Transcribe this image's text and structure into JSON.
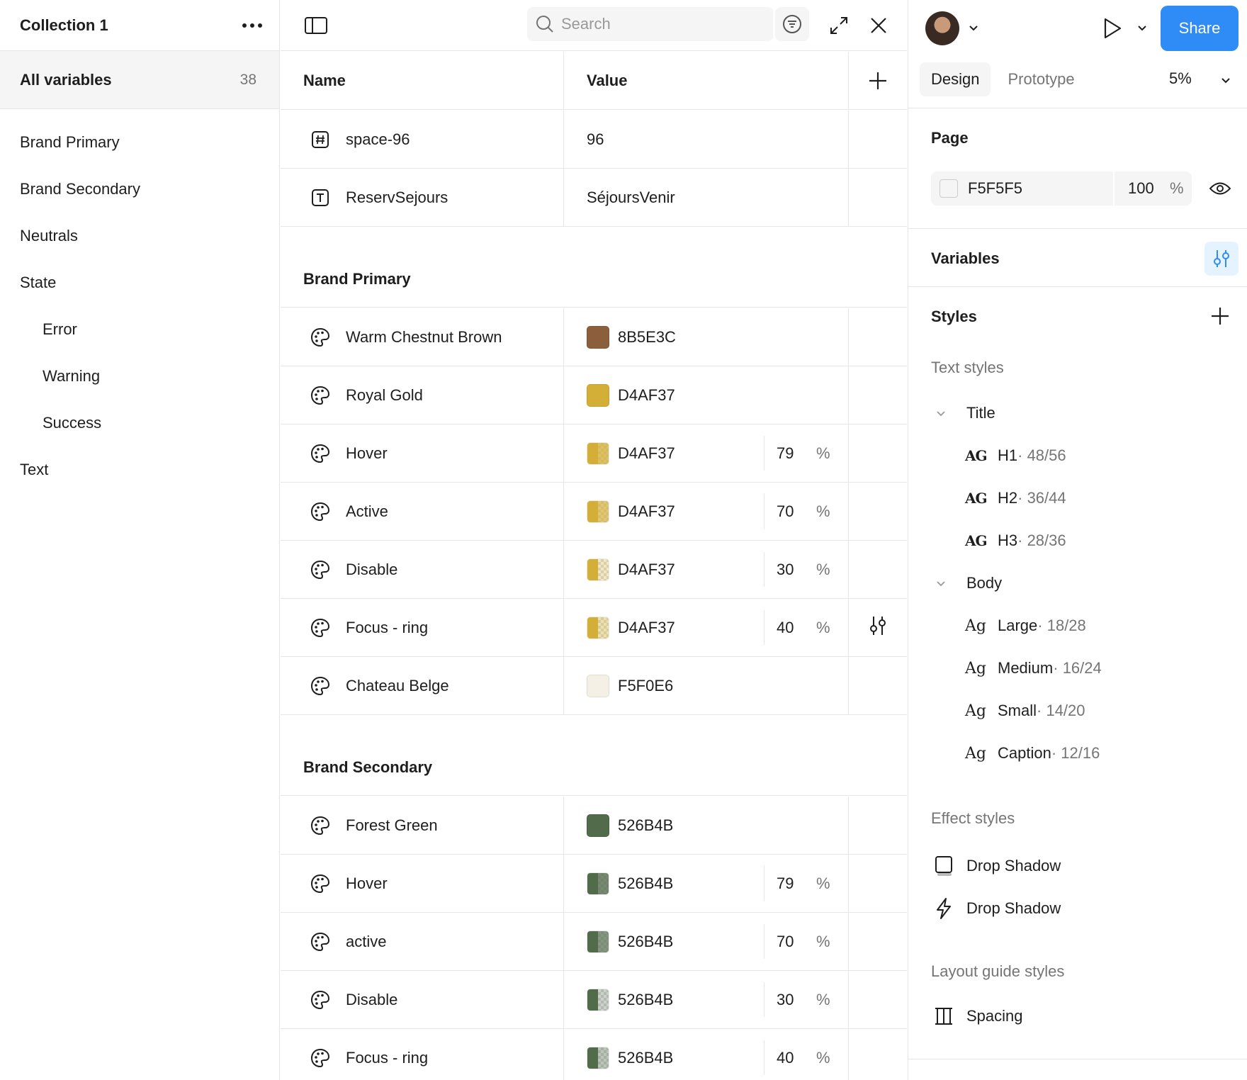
{
  "left": {
    "collection_title": "Collection 1",
    "all_variables_label": "All variables",
    "all_variables_count": "38",
    "groups": [
      {
        "label": "Brand Primary",
        "level": 0
      },
      {
        "label": "Brand Secondary",
        "level": 0
      },
      {
        "label": "Neutrals",
        "level": 0
      },
      {
        "label": "State",
        "level": 0
      },
      {
        "label": "Error",
        "level": 1
      },
      {
        "label": "Warning",
        "level": 1
      },
      {
        "label": "Success",
        "level": 1
      },
      {
        "label": "Text",
        "level": 0
      }
    ]
  },
  "center": {
    "search_placeholder": "Search",
    "col_name": "Name",
    "col_value": "Value",
    "rows_top": [
      {
        "icon": "number-icon",
        "name": "space-96",
        "value": "96"
      },
      {
        "icon": "text-icon",
        "name": "ReservSejours",
        "value": "SéjoursVenir"
      }
    ],
    "section1": {
      "title": "Brand Primary",
      "rows": [
        {
          "name": "Warm Chestnut Brown",
          "hex": "8B5E3C",
          "color": "#8B5E3C",
          "opacity": null
        },
        {
          "name": "Royal Gold",
          "hex": "D4AF37",
          "color": "#D4AF37",
          "opacity": null
        },
        {
          "name": "Hover",
          "hex": "D4AF37",
          "color": "#D4AF37",
          "opacity": "79"
        },
        {
          "name": "Active",
          "hex": "D4AF37",
          "color": "#D4AF37",
          "opacity": "70"
        },
        {
          "name": "Disable",
          "hex": "D4AF37",
          "color": "#D4AF37",
          "opacity": "30"
        },
        {
          "name": "Focus - ring",
          "hex": "D4AF37",
          "color": "#D4AF37",
          "opacity": "40"
        },
        {
          "name": "Chateau Belge",
          "hex": "F5F0E6",
          "color": "#F5F0E6",
          "opacity": null
        }
      ]
    },
    "section2": {
      "title": "Brand Secondary",
      "rows": [
        {
          "name": "Forest Green",
          "hex": "526B4B",
          "color": "#526B4B",
          "opacity": null
        },
        {
          "name": "Hover",
          "hex": "526B4B",
          "color": "#526B4B",
          "opacity": "79"
        },
        {
          "name": "active",
          "hex": "526B4B",
          "color": "#526B4B",
          "opacity": "70"
        },
        {
          "name": "Disable",
          "hex": "526B4B",
          "color": "#526B4B",
          "opacity": "30"
        },
        {
          "name": "Focus - ring",
          "hex": "526B4B",
          "color": "#526B4B",
          "opacity": "40"
        }
      ]
    },
    "percent_symbol": "%"
  },
  "right": {
    "share_label": "Share",
    "tab_design": "Design",
    "tab_prototype": "Prototype",
    "zoom": "5%",
    "page_label": "Page",
    "page_fill_hex": "F5F5F5",
    "page_fill_opacity": "100",
    "percent_symbol": "%",
    "variables_label": "Variables",
    "styles_label": "Styles",
    "text_styles_label": "Text styles",
    "title_group": "Title",
    "title_styles": [
      {
        "name": "H1",
        "meta": " · 48/56"
      },
      {
        "name": "H2",
        "meta": " · 36/44"
      },
      {
        "name": "H3",
        "meta": " · 28/36"
      }
    ],
    "body_group": "Body",
    "body_styles": [
      {
        "name": "Large",
        "meta": " · 18/28"
      },
      {
        "name": "Medium",
        "meta": " · 16/24"
      },
      {
        "name": "Small",
        "meta": " · 14/20"
      },
      {
        "name": "Caption",
        "meta": " · 12/16"
      }
    ],
    "ag_bold_glyph": "AG",
    "ag_glyph": "Ag",
    "effect_styles_label": "Effect styles",
    "effect_styles": [
      "Drop Shadow",
      "Drop Shadow"
    ],
    "layout_guide_label": "Layout guide styles",
    "layout_guides": [
      "Spacing"
    ]
  },
  "colors": {
    "accent": "#2F8BF5",
    "border": "#E6E6E6",
    "muted_text": "#757575"
  }
}
